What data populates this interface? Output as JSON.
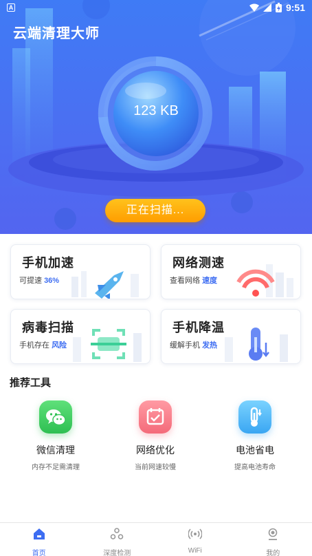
{
  "status_bar": {
    "indicator": "A",
    "time": "9:51"
  },
  "app": {
    "title": "云端清理大师"
  },
  "hero": {
    "size_label": "123 KB",
    "scan_button": "正在扫描..."
  },
  "cards": [
    {
      "title": "手机加速",
      "sub_prefix": "可提速 ",
      "sub_highlight": "36%"
    },
    {
      "title": "网络测速",
      "sub_prefix": "查看网络 ",
      "sub_highlight": "速度"
    },
    {
      "title": "病毒扫描",
      "sub_prefix": "手机存在 ",
      "sub_highlight": "风险"
    },
    {
      "title": "手机降温",
      "sub_prefix": "缓解手机 ",
      "sub_highlight": "发热"
    }
  ],
  "recommended": {
    "title": "推荐工具",
    "tools": [
      {
        "label": "微信清理",
        "sub": "内存不足需清理",
        "icon": "wechat-icon"
      },
      {
        "label": "网络优化",
        "sub": "当前网速较慢",
        "icon": "calendar-check-icon"
      },
      {
        "label": "电池省电",
        "sub": "提高电池寿命",
        "icon": "thermometer-icon"
      }
    ]
  },
  "nav": [
    {
      "label": "首页",
      "icon": "home-icon",
      "active": true
    },
    {
      "label": "深度检测",
      "icon": "recycle-icon",
      "active": false
    },
    {
      "label": "WiFi",
      "icon": "wifi-signal-icon",
      "active": false
    },
    {
      "label": "我的",
      "icon": "profile-icon",
      "active": false
    }
  ],
  "colors": {
    "primary": "#3d6df2",
    "hero": "#4b6ff2",
    "button": "#ffae0d"
  }
}
